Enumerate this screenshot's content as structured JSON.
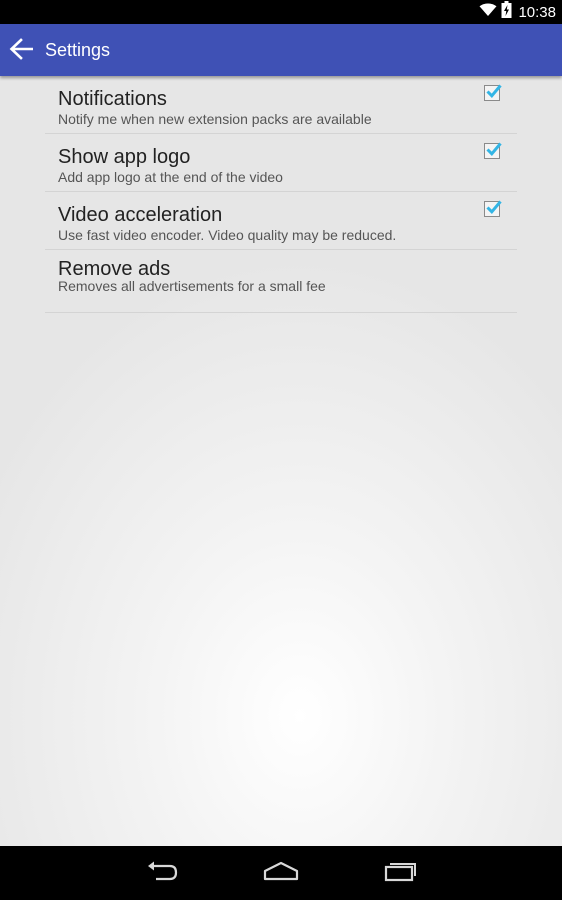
{
  "status_bar": {
    "time": "10:38",
    "icons": [
      "wifi-icon",
      "battery-charging-icon"
    ]
  },
  "action_bar": {
    "title": "Settings",
    "back_icon": "arrow-back-icon",
    "color": "#3f51b5"
  },
  "preferences": [
    {
      "title": "Notifications",
      "summary": "Notify me when new extension packs are available",
      "checked": true
    },
    {
      "title": "Show app logo",
      "summary": "Add app logo at the end of the video",
      "checked": true
    },
    {
      "title": "Video acceleration",
      "summary": "Use fast video encoder. Video quality may be reduced.",
      "checked": true
    },
    {
      "title": "Remove ads",
      "summary": "Removes all advertisements for a small fee"
    }
  ],
  "colors": {
    "checkmark": "#33b5e5",
    "action_bar": "#3f51b5"
  },
  "nav_bar": {
    "buttons": [
      "back-icon",
      "home-icon",
      "recent-apps-icon"
    ]
  }
}
